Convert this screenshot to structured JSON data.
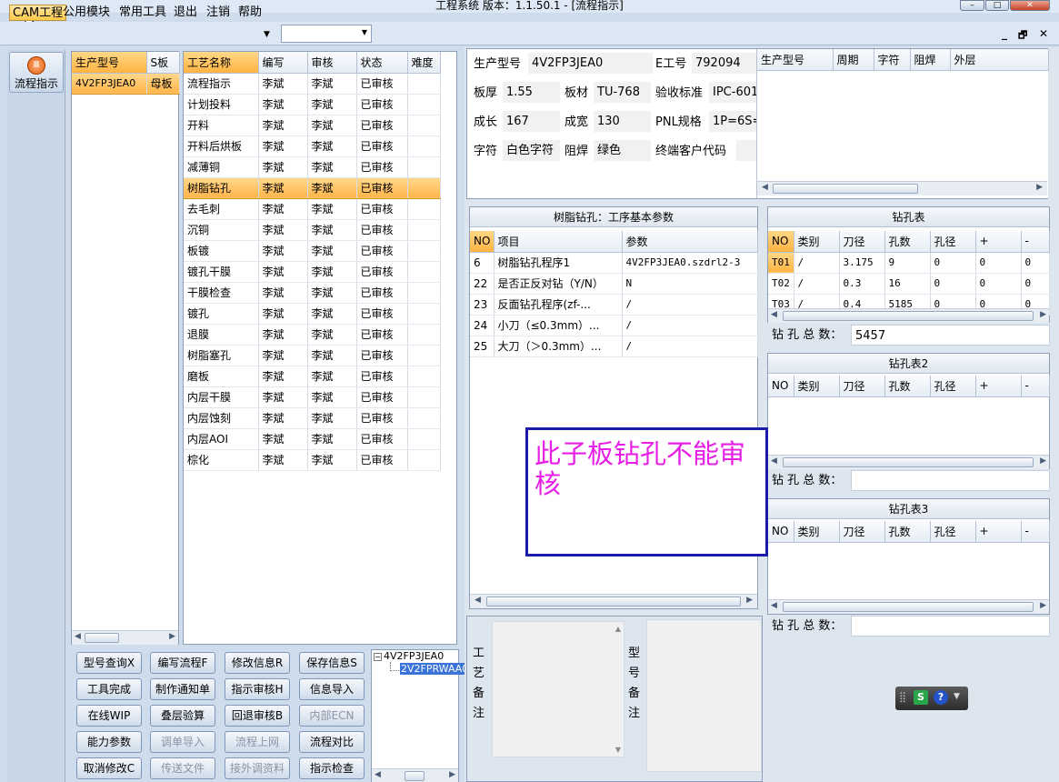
{
  "window": {
    "title": "工程系统   版本：1.1.50.1 - [流程指示]",
    "min": "–",
    "max": "□",
    "close": "✕"
  },
  "menu": {
    "items": [
      "CAM工程",
      "公用模块",
      "常用工具",
      "退出",
      "注销",
      "帮助"
    ],
    "combo_value": "",
    "mdi_min": "_",
    "mdi_restore": "🗗",
    "mdi_close": "✕"
  },
  "nav": {
    "button_label": "流程指示"
  },
  "model_list": {
    "headers": [
      "生产型号",
      "S板"
    ],
    "rows": [
      [
        "4V2FP3JEA0",
        "母板"
      ]
    ]
  },
  "process_list": {
    "headers": [
      "工艺名称",
      "编写",
      "审核",
      "状态",
      "难度"
    ],
    "rows": [
      [
        "流程指示",
        "李斌",
        "李斌",
        "已审核",
        ""
      ],
      [
        "计划投料",
        "李斌",
        "李斌",
        "已审核",
        ""
      ],
      [
        "开料",
        "李斌",
        "李斌",
        "已审核",
        ""
      ],
      [
        "开料后烘板",
        "李斌",
        "李斌",
        "已审核",
        ""
      ],
      [
        "减薄铜",
        "李斌",
        "李斌",
        "已审核",
        ""
      ],
      [
        "树脂钻孔",
        "李斌",
        "李斌",
        "已审核",
        ""
      ],
      [
        "去毛刺",
        "李斌",
        "李斌",
        "已审核",
        ""
      ],
      [
        "沉铜",
        "李斌",
        "李斌",
        "已审核",
        ""
      ],
      [
        "板镀",
        "李斌",
        "李斌",
        "已审核",
        ""
      ],
      [
        "镀孔干膜",
        "李斌",
        "李斌",
        "已审核",
        ""
      ],
      [
        "干膜检查",
        "李斌",
        "李斌",
        "已审核",
        ""
      ],
      [
        "镀孔",
        "李斌",
        "李斌",
        "已审核",
        ""
      ],
      [
        "退膜",
        "李斌",
        "李斌",
        "已审核",
        ""
      ],
      [
        "树脂塞孔",
        "李斌",
        "李斌",
        "已审核",
        ""
      ],
      [
        "磨板",
        "李斌",
        "李斌",
        "已审核",
        ""
      ],
      [
        "内层干膜",
        "李斌",
        "李斌",
        "已审核",
        ""
      ],
      [
        "内层蚀刻",
        "李斌",
        "李斌",
        "已审核",
        ""
      ],
      [
        "内层AOI",
        "李斌",
        "李斌",
        "已审核",
        ""
      ],
      [
        "棕化",
        "李斌",
        "李斌",
        "已审核",
        ""
      ]
    ]
  },
  "buttons": [
    [
      "型号查询X",
      "编写流程F",
      "修改信息R",
      "保存信息S"
    ],
    [
      "工具完成",
      "制作通知单",
      "指示审核H",
      "信息导入"
    ],
    [
      "在线WIP",
      "叠层验算",
      "回退审核B",
      "内部ECN"
    ],
    [
      "能力参数",
      "调单导入",
      "流程上网",
      "流程对比"
    ],
    [
      "取消修改C",
      "传送文件",
      "接外调资料",
      "指示检查"
    ]
  ],
  "tree": {
    "root": "4V2FP3JEA0",
    "child": "2V2FPRWAA0"
  },
  "info": {
    "model_label": "生产型号",
    "model_value": "4V2FP3JEA0",
    "eng_label": "E工号",
    "eng_value": "792094",
    "thickness_label": "板厚",
    "thickness_value": "1.55",
    "material_label": "板材",
    "material_value": "TU-768",
    "standard_label": "验收标准",
    "standard_value": "IPC-601",
    "length_label": "成长",
    "length_value": "167",
    "width_label": "成宽",
    "width_value": "130",
    "pnl_label": "PNL规格",
    "pnl_value": "1P=6S=",
    "char_label": "字符",
    "char_value": "白色字符",
    "mask_label": "阻焊",
    "mask_value": "绿色",
    "customer_label": "终端客户代码",
    "customer_value": ""
  },
  "right_grid_headers": [
    "生产型号",
    "周期",
    "字符",
    "阻焊",
    "外层"
  ],
  "params": {
    "title": "树脂钻孔：工序基本参数",
    "headers": [
      "NO",
      "项目",
      "参数"
    ],
    "rows": [
      [
        "6",
        "树脂钻孔程序1",
        "4V2FP3JEA0.szdrl2-3"
      ],
      [
        "22",
        "是否正反对钻（Y/N）",
        "N"
      ],
      [
        "23",
        "反面钻孔程序(zf-...",
        "/"
      ],
      [
        "24",
        "小刀（≤0.3mm）...",
        "/"
      ],
      [
        "25",
        "大刀（＞0.3mm）...",
        "/"
      ]
    ]
  },
  "drill1": {
    "title": "钻孔表",
    "headers": [
      "NO",
      "类别",
      "刀径",
      "孔数",
      "孔径",
      "+",
      "-"
    ],
    "rows": [
      [
        "T01",
        "/",
        "3.175",
        "9",
        "0",
        "0",
        "0"
      ],
      [
        "T02",
        "/",
        "0.3",
        "16",
        "0",
        "0",
        "0"
      ],
      [
        "T03",
        "/",
        "0.4",
        "5185",
        "0",
        "0",
        "0"
      ]
    ],
    "total_label": "钻 孔 总 数：",
    "total_value": "5457"
  },
  "drill2": {
    "title": "钻孔表2",
    "headers": [
      "NO",
      "类别",
      "刀径",
      "孔数",
      "孔径",
      "+",
      "-"
    ],
    "total_label": "钻 孔 总 数：",
    "total_value": ""
  },
  "drill3": {
    "title": "钻孔表3",
    "headers": [
      "NO",
      "类别",
      "刀径",
      "孔数",
      "孔径",
      "+",
      "-"
    ],
    "total_label": "钻 孔 总 数：",
    "total_value": ""
  },
  "notes": {
    "process_label": "工艺备注",
    "model_label": "型号备注"
  },
  "popup": {
    "message": "此子板钻孔不能审核"
  },
  "colors": {
    "popup_text": "#e61ee6",
    "popup_border": "#1a1aa8",
    "selected_row": "#ffb54a"
  }
}
